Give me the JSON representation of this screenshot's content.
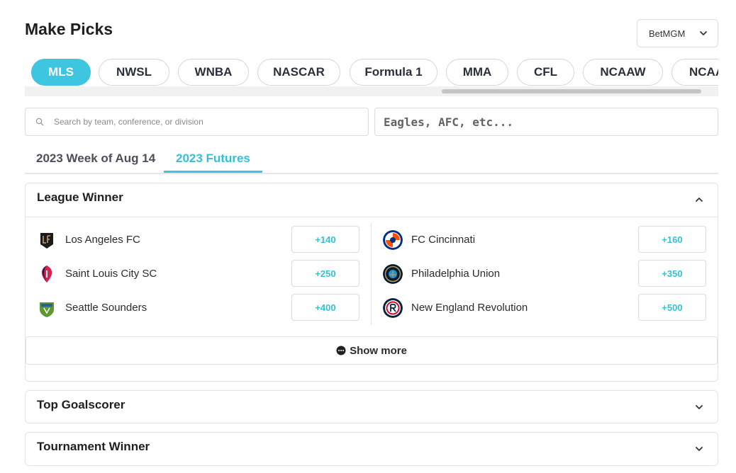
{
  "page_title": "Make Picks",
  "sportsbook": {
    "selected": "BetMGM"
  },
  "leagues": [
    {
      "label": "MLS",
      "active": true
    },
    {
      "label": "NWSL"
    },
    {
      "label": "WNBA"
    },
    {
      "label": "NASCAR"
    },
    {
      "label": "Formula 1"
    },
    {
      "label": "MMA"
    },
    {
      "label": "CFL"
    },
    {
      "label": "NCAAW"
    },
    {
      "label": "NCAAF"
    }
  ],
  "search": {
    "placeholder": "Search by team, conference, or division"
  },
  "team_filter": {
    "placeholder": "Eagles, AFC, etc..."
  },
  "tabs": [
    {
      "label": "2023 Week of Aug 14"
    },
    {
      "label": "2023 Futures",
      "active": true
    }
  ],
  "league_winner": {
    "title": "League Winner",
    "left": [
      {
        "name": "Los Angeles FC",
        "odds": "+140",
        "logo": "lafc-logo"
      },
      {
        "name": "Saint Louis City SC",
        "odds": "+250",
        "logo": "st-louis-city-logo"
      },
      {
        "name": "Seattle Sounders",
        "odds": "+400",
        "logo": "seattle-sounders-logo"
      }
    ],
    "right": [
      {
        "name": "FC Cincinnati",
        "odds": "+160",
        "logo": "fc-cincinnati-logo"
      },
      {
        "name": "Philadelphia Union",
        "odds": "+350",
        "logo": "philadelphia-union-logo"
      },
      {
        "name": "New England Revolution",
        "odds": "+500",
        "logo": "new-england-revolution-logo"
      }
    ],
    "show_more": "Show more"
  },
  "top_goalscorer": {
    "title": "Top Goalscorer"
  },
  "tournament_winner": {
    "title": "Tournament Winner"
  },
  "colors": {
    "accent": "#3ec6e0",
    "border": "#dcdcdc",
    "text": "#1f1f1f"
  }
}
